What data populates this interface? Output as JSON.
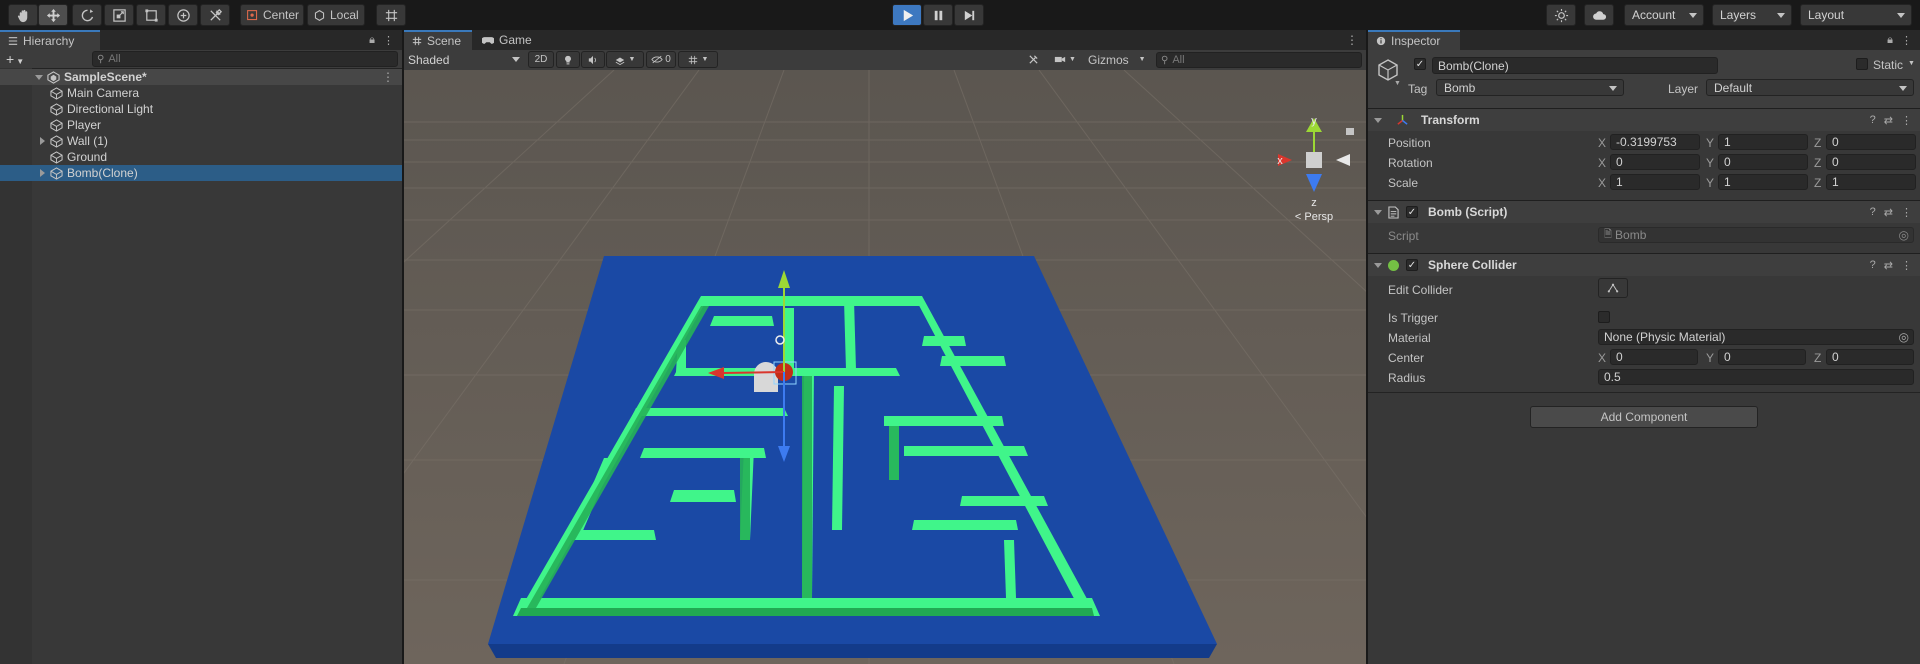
{
  "toolbar": {
    "tools": [
      "hand-tool",
      "move-tool",
      "rotate-tool",
      "scale-tool",
      "rect-tool",
      "transform-tool",
      "custom-tool"
    ],
    "pivot_label": "Center",
    "space_label": "Local",
    "account_label": "Account",
    "layers_label": "Layers",
    "layout_label": "Layout"
  },
  "hierarchy": {
    "tab_label": "Hierarchy",
    "search_placeholder": "All",
    "scene_name": "SampleScene*",
    "items": [
      {
        "label": "Main Camera",
        "expandable": false,
        "selected": false
      },
      {
        "label": "Directional Light",
        "expandable": false,
        "selected": false
      },
      {
        "label": "Player",
        "expandable": false,
        "selected": false
      },
      {
        "label": "Wall (1)",
        "expandable": true,
        "selected": false
      },
      {
        "label": "Ground",
        "expandable": false,
        "selected": false
      },
      {
        "label": "Bomb(Clone)",
        "expandable": true,
        "selected": true
      }
    ]
  },
  "scene": {
    "tabs": [
      {
        "label": "Scene",
        "active": true
      },
      {
        "label": "Game",
        "active": false
      }
    ],
    "shading_mode": "Shaded",
    "mode_2d": "2D",
    "hidden_count": "0",
    "gizmos_label": "Gizmos",
    "search_placeholder": "All",
    "orientation": {
      "x": "x",
      "y": "y",
      "z": "z",
      "projection": "< Persp"
    }
  },
  "inspector": {
    "tab_label": "Inspector",
    "object_name": "Bomb(Clone)",
    "static_label": "Static",
    "tag_label": "Tag",
    "tag_value": "Bomb",
    "layer_label": "Layer",
    "layer_value": "Default",
    "transform": {
      "title": "Transform",
      "rows": [
        {
          "label": "Position",
          "x": "-0.3199753",
          "y": "1",
          "z": "0"
        },
        {
          "label": "Rotation",
          "x": "0",
          "y": "0",
          "z": "0"
        },
        {
          "label": "Scale",
          "x": "1",
          "y": "1",
          "z": "1"
        }
      ]
    },
    "script_component": {
      "title": "Bomb (Script)",
      "script_label": "Script",
      "script_value": "Bomb"
    },
    "sphere_collider": {
      "title": "Sphere Collider",
      "edit_collider_label": "Edit Collider",
      "is_trigger_label": "Is Trigger",
      "material_label": "Material",
      "material_value": "None (Physic Material)",
      "center_label": "Center",
      "center": {
        "x": "0",
        "y": "0",
        "z": "0"
      },
      "radius_label": "Radius",
      "radius_value": "0.5"
    },
    "add_component_label": "Add Component"
  },
  "axis_labels": {
    "x": "X",
    "y": "Y",
    "z": "Z"
  },
  "colors": {
    "accent": "#3a79bb",
    "selection": "#2c5d87",
    "maze_wall": "#36e07a",
    "maze_floor": "#1f56c8"
  }
}
